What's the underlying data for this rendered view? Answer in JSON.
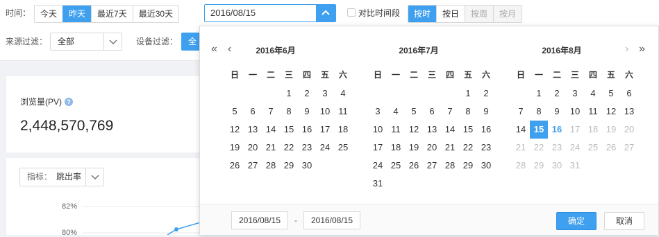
{
  "toolbar": {
    "time_label": "时间：",
    "quick_ranges": [
      "今天",
      "昨天",
      "最近7天",
      "最近30天"
    ],
    "quick_active": 1,
    "date_value": "2016/08/15",
    "compare_label": "对比时间段",
    "granularity": [
      "按时",
      "按日",
      "按周",
      "按月"
    ],
    "granularity_active": 0,
    "source_label": "来源过滤：",
    "source_value": "全部",
    "device_label": "设备过滤：",
    "device_value": "全"
  },
  "metric": {
    "title": "浏览量(PV)",
    "help": "?",
    "value": "2,448,570,769"
  },
  "chart": {
    "indicator_label": "指标：",
    "indicator_value": "跳出率",
    "y_ticks": [
      "82%",
      "80%"
    ]
  },
  "chart_data": {
    "type": "line",
    "ylabel": "",
    "y_ticks": [
      "82%",
      "80%"
    ]
  },
  "datepicker": {
    "weekdays": [
      "日",
      "一",
      "二",
      "三",
      "四",
      "五",
      "六"
    ],
    "months": [
      {
        "title": "2016年6月",
        "offset": 3,
        "days": 30
      },
      {
        "title": "2016年7月",
        "offset": 5,
        "days": 31
      },
      {
        "title": "2016年8月",
        "offset": 1,
        "days": 31,
        "selected": 15,
        "today": 16
      }
    ],
    "nav": {
      "prev_year": "«",
      "prev_month": "‹",
      "next_month": "›",
      "next_year": "»"
    },
    "range_start": "2016/08/15",
    "range_sep": "-",
    "range_end": "2016/08/15",
    "ok_label": "确定",
    "cancel_label": "取消"
  },
  "colors": {
    "accent": "#3fa0f0",
    "disabled_text": "#bcbcbc"
  }
}
